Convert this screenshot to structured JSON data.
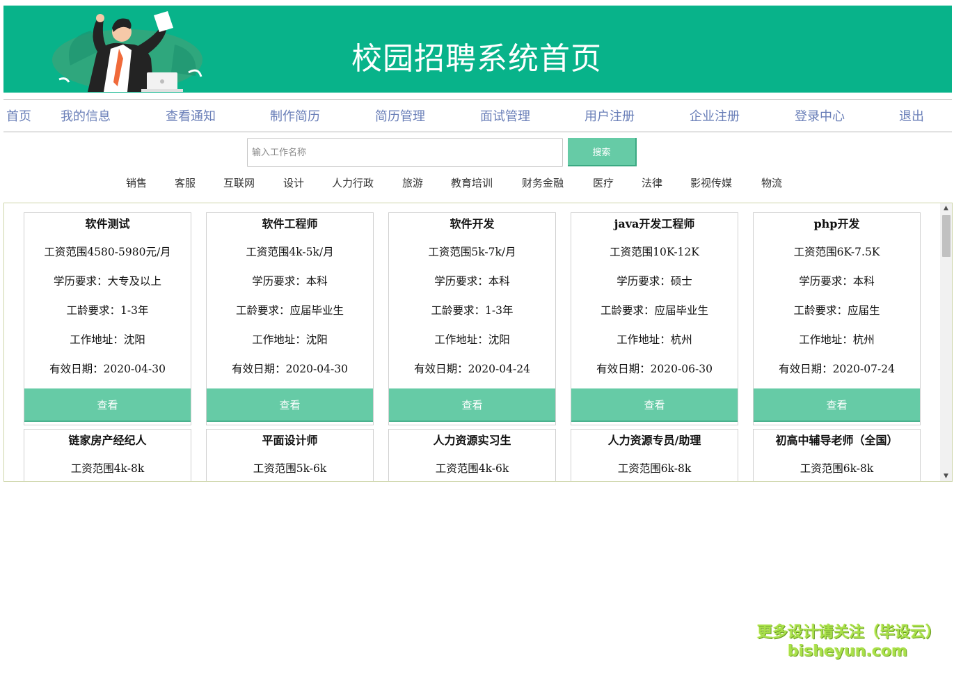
{
  "banner": {
    "title": "校园招聘系统首页",
    "illustration": "businessman-celebrating-with-laptop"
  },
  "nav": [
    "首页",
    "我的信息",
    "查看通知",
    "制作简历",
    "简历管理",
    "面试管理",
    "用户注册",
    "企业注册",
    "登录中心",
    "退出"
  ],
  "search": {
    "placeholder": "输入工作名称",
    "value": "",
    "button_label": "搜索"
  },
  "categories": [
    "销售",
    "客服",
    "互联网",
    "设计",
    "人力行政",
    "旅游",
    "教育培训",
    "财务金融",
    "医疗",
    "法律",
    "影视传媒",
    "物流"
  ],
  "jobs": [
    {
      "title": "软件测试",
      "salary": "工资范围4580-5980元/月",
      "education": "学历要求：大专及以上",
      "experience": "工龄要求：1-3年",
      "location": "工作地址：沈阳",
      "valid": "有效日期：2020-04-30",
      "view": "查看"
    },
    {
      "title": "软件工程师",
      "salary": "工资范围4k-5k/月",
      "education": "学历要求：本科",
      "experience": "工龄要求：应届毕业生",
      "location": "工作地址：沈阳",
      "valid": "有效日期：2020-04-30",
      "view": "查看"
    },
    {
      "title": "软件开发",
      "salary": "工资范围5k-7k/月",
      "education": "学历要求：本科",
      "experience": "工龄要求：1-3年",
      "location": "工作地址：沈阳",
      "valid": "有效日期：2020-04-24",
      "view": "查看"
    },
    {
      "title": "java开发工程师",
      "salary": "工资范围10K-12K",
      "education": "学历要求：硕士",
      "experience": "工龄要求：应届毕业生",
      "location": "工作地址：杭州",
      "valid": "有效日期：2020-06-30",
      "view": "查看"
    },
    {
      "title": "php开发",
      "salary": "工资范围6K-7.5K",
      "education": "学历要求：本科",
      "experience": "工龄要求：应届生",
      "location": "工作地址：杭州",
      "valid": "有效日期：2020-07-24",
      "view": "查看"
    },
    {
      "title": "链家房产经纪人",
      "salary": "工资范围4k-8k"
    },
    {
      "title": "平面设计师",
      "salary": "工资范围5k-6k"
    },
    {
      "title": "人力资源实习生",
      "salary": "工资范围4k-6k"
    },
    {
      "title": "人力资源专员/助理",
      "salary": "工资范围6k-8k"
    },
    {
      "title": "初高中辅导老师（全国）",
      "salary": "工资范围6k-8k"
    }
  ],
  "watermark": {
    "line1": "更多设计请关注（毕设云）",
    "line2": "bisheyun.com"
  },
  "colors": {
    "brand": "#08b38a",
    "button": "#66cba6",
    "nav_text": "#6a7fb8"
  }
}
